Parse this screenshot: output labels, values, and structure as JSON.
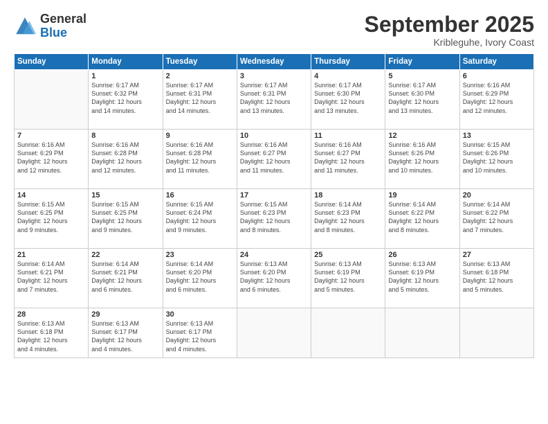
{
  "logo": {
    "general": "General",
    "blue": "Blue"
  },
  "header": {
    "month": "September 2025",
    "location": "Kribleguhe, Ivory Coast"
  },
  "weekdays": [
    "Sunday",
    "Monday",
    "Tuesday",
    "Wednesday",
    "Thursday",
    "Friday",
    "Saturday"
  ],
  "weeks": [
    [
      {
        "day": "",
        "info": ""
      },
      {
        "day": "1",
        "info": "Sunrise: 6:17 AM\nSunset: 6:32 PM\nDaylight: 12 hours\nand 14 minutes."
      },
      {
        "day": "2",
        "info": "Sunrise: 6:17 AM\nSunset: 6:31 PM\nDaylight: 12 hours\nand 14 minutes."
      },
      {
        "day": "3",
        "info": "Sunrise: 6:17 AM\nSunset: 6:31 PM\nDaylight: 12 hours\nand 13 minutes."
      },
      {
        "day": "4",
        "info": "Sunrise: 6:17 AM\nSunset: 6:30 PM\nDaylight: 12 hours\nand 13 minutes."
      },
      {
        "day": "5",
        "info": "Sunrise: 6:17 AM\nSunset: 6:30 PM\nDaylight: 12 hours\nand 13 minutes."
      },
      {
        "day": "6",
        "info": "Sunrise: 6:16 AM\nSunset: 6:29 PM\nDaylight: 12 hours\nand 12 minutes."
      }
    ],
    [
      {
        "day": "7",
        "info": "Sunrise: 6:16 AM\nSunset: 6:29 PM\nDaylight: 12 hours\nand 12 minutes."
      },
      {
        "day": "8",
        "info": "Sunrise: 6:16 AM\nSunset: 6:28 PM\nDaylight: 12 hours\nand 12 minutes."
      },
      {
        "day": "9",
        "info": "Sunrise: 6:16 AM\nSunset: 6:28 PM\nDaylight: 12 hours\nand 11 minutes."
      },
      {
        "day": "10",
        "info": "Sunrise: 6:16 AM\nSunset: 6:27 PM\nDaylight: 12 hours\nand 11 minutes."
      },
      {
        "day": "11",
        "info": "Sunrise: 6:16 AM\nSunset: 6:27 PM\nDaylight: 12 hours\nand 11 minutes."
      },
      {
        "day": "12",
        "info": "Sunrise: 6:16 AM\nSunset: 6:26 PM\nDaylight: 12 hours\nand 10 minutes."
      },
      {
        "day": "13",
        "info": "Sunrise: 6:15 AM\nSunset: 6:26 PM\nDaylight: 12 hours\nand 10 minutes."
      }
    ],
    [
      {
        "day": "14",
        "info": "Sunrise: 6:15 AM\nSunset: 6:25 PM\nDaylight: 12 hours\nand 9 minutes."
      },
      {
        "day": "15",
        "info": "Sunrise: 6:15 AM\nSunset: 6:25 PM\nDaylight: 12 hours\nand 9 minutes."
      },
      {
        "day": "16",
        "info": "Sunrise: 6:15 AM\nSunset: 6:24 PM\nDaylight: 12 hours\nand 9 minutes."
      },
      {
        "day": "17",
        "info": "Sunrise: 6:15 AM\nSunset: 6:23 PM\nDaylight: 12 hours\nand 8 minutes."
      },
      {
        "day": "18",
        "info": "Sunrise: 6:14 AM\nSunset: 6:23 PM\nDaylight: 12 hours\nand 8 minutes."
      },
      {
        "day": "19",
        "info": "Sunrise: 6:14 AM\nSunset: 6:22 PM\nDaylight: 12 hours\nand 8 minutes."
      },
      {
        "day": "20",
        "info": "Sunrise: 6:14 AM\nSunset: 6:22 PM\nDaylight: 12 hours\nand 7 minutes."
      }
    ],
    [
      {
        "day": "21",
        "info": "Sunrise: 6:14 AM\nSunset: 6:21 PM\nDaylight: 12 hours\nand 7 minutes."
      },
      {
        "day": "22",
        "info": "Sunrise: 6:14 AM\nSunset: 6:21 PM\nDaylight: 12 hours\nand 6 minutes."
      },
      {
        "day": "23",
        "info": "Sunrise: 6:14 AM\nSunset: 6:20 PM\nDaylight: 12 hours\nand 6 minutes."
      },
      {
        "day": "24",
        "info": "Sunrise: 6:13 AM\nSunset: 6:20 PM\nDaylight: 12 hours\nand 6 minutes."
      },
      {
        "day": "25",
        "info": "Sunrise: 6:13 AM\nSunset: 6:19 PM\nDaylight: 12 hours\nand 5 minutes."
      },
      {
        "day": "26",
        "info": "Sunrise: 6:13 AM\nSunset: 6:19 PM\nDaylight: 12 hours\nand 5 minutes."
      },
      {
        "day": "27",
        "info": "Sunrise: 6:13 AM\nSunset: 6:18 PM\nDaylight: 12 hours\nand 5 minutes."
      }
    ],
    [
      {
        "day": "28",
        "info": "Sunrise: 6:13 AM\nSunset: 6:18 PM\nDaylight: 12 hours\nand 4 minutes."
      },
      {
        "day": "29",
        "info": "Sunrise: 6:13 AM\nSunset: 6:17 PM\nDaylight: 12 hours\nand 4 minutes."
      },
      {
        "day": "30",
        "info": "Sunrise: 6:13 AM\nSunset: 6:17 PM\nDaylight: 12 hours\nand 4 minutes."
      },
      {
        "day": "",
        "info": ""
      },
      {
        "day": "",
        "info": ""
      },
      {
        "day": "",
        "info": ""
      },
      {
        "day": "",
        "info": ""
      }
    ]
  ]
}
